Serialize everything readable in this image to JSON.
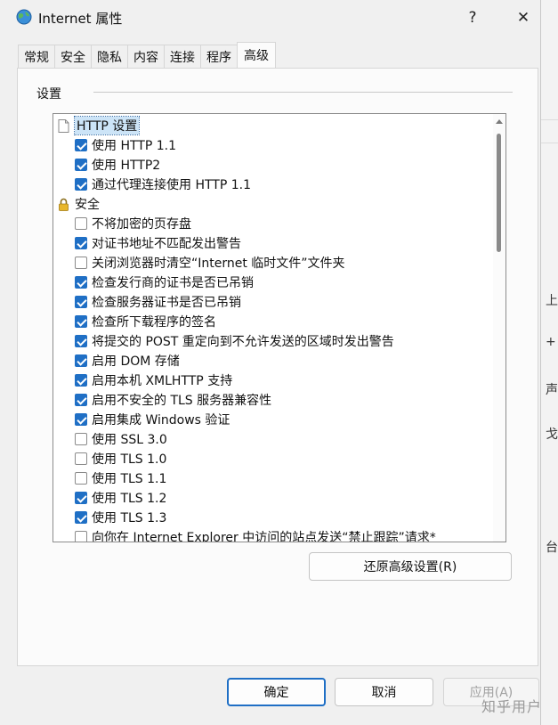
{
  "window": {
    "title": "Internet 属性",
    "help_label": "?",
    "close_label": "✕"
  },
  "tabs": [
    {
      "label": "常规",
      "active": false
    },
    {
      "label": "安全",
      "active": false
    },
    {
      "label": "隐私",
      "active": false
    },
    {
      "label": "内容",
      "active": false
    },
    {
      "label": "连接",
      "active": false
    },
    {
      "label": "程序",
      "active": false
    },
    {
      "label": "高级",
      "active": true
    }
  ],
  "settings_group": {
    "label": "设置"
  },
  "tree": [
    {
      "type": "header",
      "icon": "page-icon",
      "label": "HTTP 设置",
      "selected": true
    },
    {
      "type": "checkbox",
      "checked": true,
      "label": "使用 HTTP 1.1"
    },
    {
      "type": "checkbox",
      "checked": true,
      "label": "使用 HTTP2"
    },
    {
      "type": "checkbox",
      "checked": true,
      "label": "通过代理连接使用 HTTP 1.1"
    },
    {
      "type": "header",
      "icon": "lock-icon",
      "label": "安全",
      "selected": false
    },
    {
      "type": "checkbox",
      "checked": false,
      "label": "不将加密的页存盘"
    },
    {
      "type": "checkbox",
      "checked": true,
      "label": "对证书地址不匹配发出警告"
    },
    {
      "type": "checkbox",
      "checked": false,
      "label": "关闭浏览器时清空“Internet 临时文件”文件夹"
    },
    {
      "type": "checkbox",
      "checked": true,
      "label": "检查发行商的证书是否已吊销"
    },
    {
      "type": "checkbox",
      "checked": true,
      "label": "检查服务器证书是否已吊销"
    },
    {
      "type": "checkbox",
      "checked": true,
      "label": "检查所下载程序的签名"
    },
    {
      "type": "checkbox",
      "checked": true,
      "label": "将提交的 POST 重定向到不允许发送的区域时发出警告"
    },
    {
      "type": "checkbox",
      "checked": true,
      "label": "启用 DOM 存储"
    },
    {
      "type": "checkbox",
      "checked": true,
      "label": "启用本机 XMLHTTP 支持"
    },
    {
      "type": "checkbox",
      "checked": true,
      "label": "启用不安全的 TLS 服务器兼容性"
    },
    {
      "type": "checkbox",
      "checked": true,
      "label": "启用集成 Windows 验证"
    },
    {
      "type": "checkbox",
      "checked": false,
      "label": "使用 SSL 3.0"
    },
    {
      "type": "checkbox",
      "checked": false,
      "label": "使用 TLS 1.0"
    },
    {
      "type": "checkbox",
      "checked": false,
      "label": "使用 TLS 1.1"
    },
    {
      "type": "checkbox",
      "checked": true,
      "label": "使用 TLS 1.2"
    },
    {
      "type": "checkbox",
      "checked": true,
      "label": "使用 TLS 1.3"
    },
    {
      "type": "checkbox",
      "checked": false,
      "label": "向你在 Internet Explorer 中访问的站点发送“禁止跟踪”请求*"
    }
  ],
  "buttons": {
    "restore_advanced": "还原高级设置(R)",
    "ok": "确定",
    "cancel": "取消",
    "apply": "应用(A)"
  },
  "background": {
    "chars": [
      "上",
      "+",
      "声",
      "戈",
      "台"
    ],
    "watermark": "知乎用户"
  },
  "colors": {
    "accent": "#1f6fc5",
    "selection": "#cce4f7"
  }
}
